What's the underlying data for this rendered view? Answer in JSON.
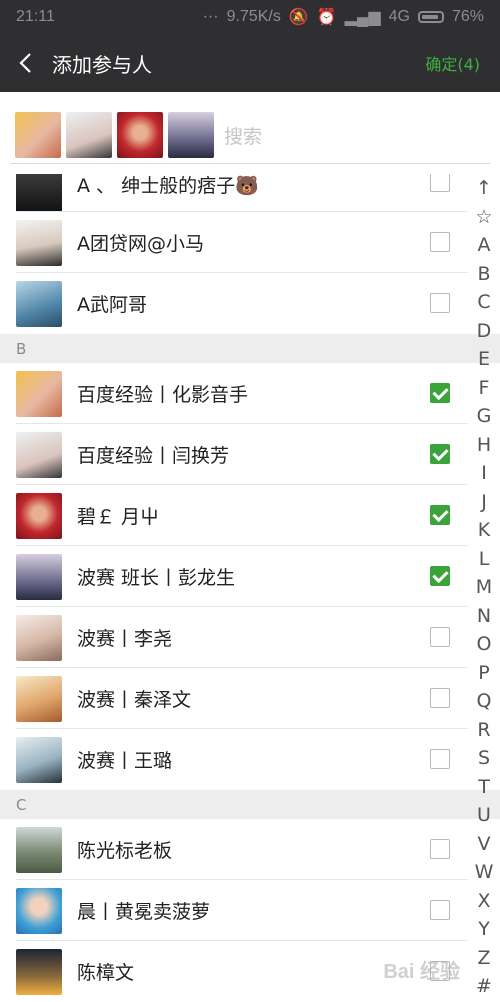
{
  "status_bar": {
    "time": "21:11",
    "net_speed": "9.75K/s",
    "network": "4G",
    "battery": "76%"
  },
  "header": {
    "title": "添加参与人",
    "confirm_label": "确定(4)"
  },
  "search": {
    "placeholder": "搜索"
  },
  "selected": [
    {
      "name": "百度经验丨化影音手"
    },
    {
      "name": "百度经验丨闫换芳"
    },
    {
      "name": "碧￡ 月屮"
    },
    {
      "name": "波赛 班长丨彭龙生"
    }
  ],
  "list": {
    "partial_first": {
      "name": "A 、      绅士般的痞子🐻",
      "checked": false
    },
    "A": [
      {
        "name": "A团贷网@小马",
        "checked": false
      },
      {
        "name": "A武阿哥",
        "checked": false
      }
    ],
    "B": {
      "header": "B",
      "items": [
        {
          "name": "百度经验丨化影音手",
          "checked": true
        },
        {
          "name": "百度经验丨闫换芳",
          "checked": true
        },
        {
          "name": "碧￡ 月屮",
          "checked": true
        },
        {
          "name": "波赛 班长丨彭龙生",
          "checked": true
        },
        {
          "name": "波赛丨李尧",
          "checked": false
        },
        {
          "name": "波赛丨秦泽文",
          "checked": false
        },
        {
          "name": "波赛丨王璐",
          "checked": false
        }
      ]
    },
    "C": {
      "header": "C",
      "items": [
        {
          "name": "陈光标老板",
          "checked": false
        },
        {
          "name": "晨丨黄冕卖菠萝",
          "checked": false
        },
        {
          "name": "陈樟文",
          "checked": false
        }
      ]
    }
  },
  "index_letters": [
    "↑",
    "☆",
    "A",
    "B",
    "C",
    "D",
    "E",
    "F",
    "G",
    "H",
    "I",
    "J",
    "K",
    "L",
    "M",
    "N",
    "O",
    "P",
    "Q",
    "R",
    "S",
    "T",
    "U",
    "V",
    "W",
    "X",
    "Y",
    "Z",
    "#"
  ],
  "watermark": "Bai 经验",
  "colors": {
    "header_bg": "#2f2f31",
    "accent_green": "#3fae3f",
    "section_bg": "#ededed"
  }
}
